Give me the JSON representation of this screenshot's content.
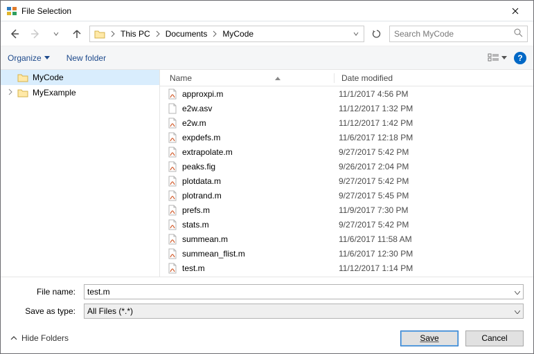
{
  "window": {
    "title": "File Selection"
  },
  "breadcrumb": {
    "items": [
      "This PC",
      "Documents",
      "MyCode"
    ]
  },
  "search": {
    "placeholder": "Search MyCode"
  },
  "toolbar": {
    "organize": "Organize",
    "newfolder": "New folder"
  },
  "tree": {
    "items": [
      {
        "label": "MyCode",
        "selected": true
      },
      {
        "label": "MyExample",
        "selected": false
      }
    ]
  },
  "list": {
    "headers": {
      "name": "Name",
      "date": "Date modified"
    },
    "rows": [
      {
        "name": "approxpi.m",
        "date": "11/1/2017 4:56 PM",
        "kind": "m"
      },
      {
        "name": "e2w.asv",
        "date": "11/12/2017 1:32 PM",
        "kind": "asv"
      },
      {
        "name": "e2w.m",
        "date": "11/12/2017 1:42 PM",
        "kind": "m"
      },
      {
        "name": "expdefs.m",
        "date": "11/6/2017 12:18 PM",
        "kind": "m"
      },
      {
        "name": "extrapolate.m",
        "date": "9/27/2017 5:42 PM",
        "kind": "m"
      },
      {
        "name": "peaks.fig",
        "date": "9/26/2017 2:04 PM",
        "kind": "fig"
      },
      {
        "name": "plotdata.m",
        "date": "9/27/2017 5:42 PM",
        "kind": "m"
      },
      {
        "name": "plotrand.m",
        "date": "9/27/2017 5:45 PM",
        "kind": "m"
      },
      {
        "name": "prefs.m",
        "date": "11/9/2017 7:30 PM",
        "kind": "m"
      },
      {
        "name": "stats.m",
        "date": "9/27/2017 5:42 PM",
        "kind": "m"
      },
      {
        "name": "summean.m",
        "date": "11/6/2017 11:58 AM",
        "kind": "m"
      },
      {
        "name": "summean_flist.m",
        "date": "11/6/2017 12:30 PM",
        "kind": "m"
      },
      {
        "name": "test.m",
        "date": "11/12/2017 1:14 PM",
        "kind": "m"
      }
    ]
  },
  "bottom": {
    "filename_label": "File name:",
    "filename_value": "test.m",
    "type_label": "Save as type:",
    "type_value": "All Files (*.*)"
  },
  "footer": {
    "hide_folders": "Hide Folders",
    "save": "Save",
    "cancel": "Cancel"
  },
  "icons": {
    "help": "?"
  }
}
